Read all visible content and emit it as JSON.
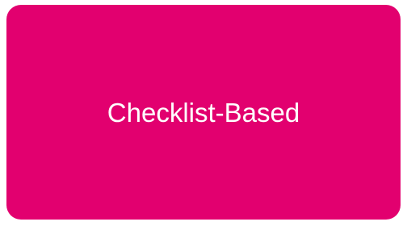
{
  "card": {
    "label": "Checklist-Based",
    "background_color": "#E2006F",
    "text_color": "#FFFFFF"
  }
}
